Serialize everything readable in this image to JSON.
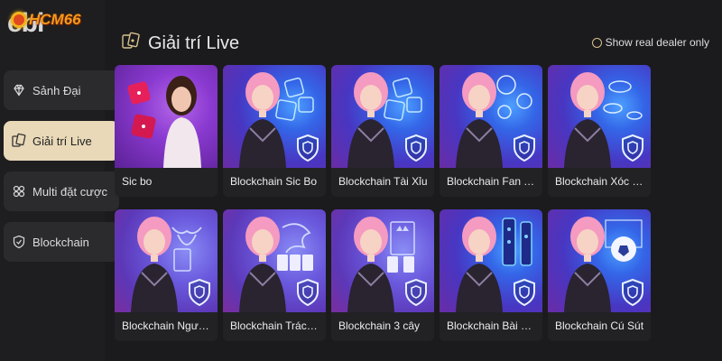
{
  "brand": {
    "logo_text": "HCM66",
    "watermark": "ebi"
  },
  "colors": {
    "sidebar_bg": "#1e1e20",
    "nav_bg": "#2b2b2e",
    "nav_active_bg": "#e9d9b8",
    "accent": "#d7c18e",
    "card_caption_bg": "#222225"
  },
  "sidebar": {
    "items": [
      {
        "label": "Sảnh Đại",
        "icon": "diamond-icon",
        "active": false
      },
      {
        "label": "Giải trí Live",
        "icon": "cards-icon",
        "active": true
      },
      {
        "label": "Multi đặt cược",
        "icon": "multi-bet-icon",
        "active": false
      },
      {
        "label": "Blockchain",
        "icon": "shield-icon",
        "active": false
      }
    ]
  },
  "header": {
    "title": "Giải trí Live",
    "title_icon": "cards-icon",
    "toggle_label": "Show real dealer only"
  },
  "games": [
    {
      "label": "Sic bo",
      "theme": "sicbo",
      "icon": "dice-icon"
    },
    {
      "label": "Blockchain Sic Bo",
      "theme": "blockchain",
      "icon": "dice-icon"
    },
    {
      "label": "Blockchain Tài Xỉu",
      "theme": "blockchain",
      "icon": "dice-icon"
    },
    {
      "label": "Blockchain Fan Tan",
      "theme": "blockchain",
      "icon": "bubbles-icon"
    },
    {
      "label": "Blockchain Xóc Đĩa",
      "theme": "blockchain",
      "icon": "coins-icon"
    },
    {
      "label": "Blockchain Ngưu...",
      "theme": "blockchain2",
      "icon": "bull-icon"
    },
    {
      "label": "Blockchain Trác Kim...",
      "theme": "blockchain2",
      "icon": "dragon-icon"
    },
    {
      "label": "Blockchain 3 cây",
      "theme": "blockchain2",
      "icon": "king-card-icon"
    },
    {
      "label": "Blockchain Bài Cửu...",
      "theme": "blockchain",
      "icon": "domino-icon"
    },
    {
      "label": "Blockchain Cú Sút",
      "theme": "blockchain",
      "icon": "football-icon"
    }
  ]
}
